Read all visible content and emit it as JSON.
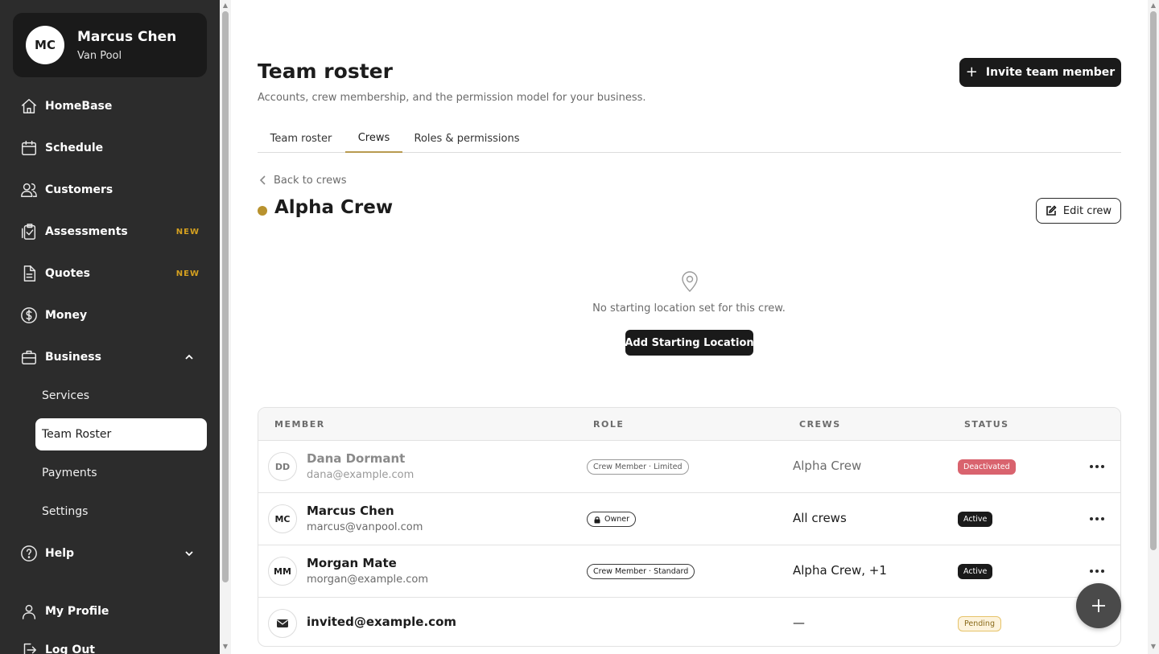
{
  "profile": {
    "initials": "MC",
    "name": "Marcus Chen",
    "org": "Van Pool"
  },
  "nav": {
    "home": "HomeBase",
    "schedule": "Schedule",
    "customers": "Customers",
    "assessments": "Assessments",
    "assessments_badge": "NEW",
    "quotes": "Quotes",
    "quotes_badge": "NEW",
    "money": "Money",
    "business": "Business",
    "business_sub": [
      "Services",
      "Team Roster",
      "Payments",
      "Settings"
    ],
    "help": "Help",
    "my_profile": "My Profile",
    "log_out": "Log Out"
  },
  "header": {
    "title": "Team roster",
    "subtitle": "Accounts, crew membership, and the permission model for your business.",
    "invite_label": "Invite team member"
  },
  "tabs": [
    "Team roster",
    "Crews",
    "Roles & permissions"
  ],
  "active_tab": "Crews",
  "crew": {
    "back_label": "Back to crews",
    "name": "Alpha Crew",
    "color": "#b8922e",
    "edit_label": "Edit crew",
    "empty_text": "No starting location set for this crew.",
    "add_location_label": "Add Starting Location"
  },
  "table": {
    "headers": {
      "member": "MEMBER",
      "role": "ROLE",
      "crews": "CREWS",
      "status": "STATUS"
    },
    "rows": [
      {
        "initials": "DD",
        "name": "Dana Dormant",
        "email": "dana@example.com",
        "role": "Crew Member · Limited",
        "crews": "Alpha Crew",
        "status": "Deactivated"
      },
      {
        "initials": "MC",
        "name": "Marcus Chen",
        "email": "marcus@vanpool.com",
        "role": "Owner",
        "crews": "All crews",
        "status": "Active"
      },
      {
        "initials": "MM",
        "name": "Morgan Mate",
        "email": "morgan@example.com",
        "role": "Crew Member · Standard",
        "crews": "Alpha Crew, +1",
        "status": "Active"
      },
      {
        "initials": "",
        "name": "invited@example.com",
        "email": "",
        "role": "",
        "crews": "—",
        "status": "Pending"
      }
    ]
  },
  "colors": {
    "sidebar_bg": "#2c2c2c",
    "accent_gold": "#d4a020",
    "deactivated": "#d9636e",
    "primary_btn": "#1a1a1a"
  }
}
